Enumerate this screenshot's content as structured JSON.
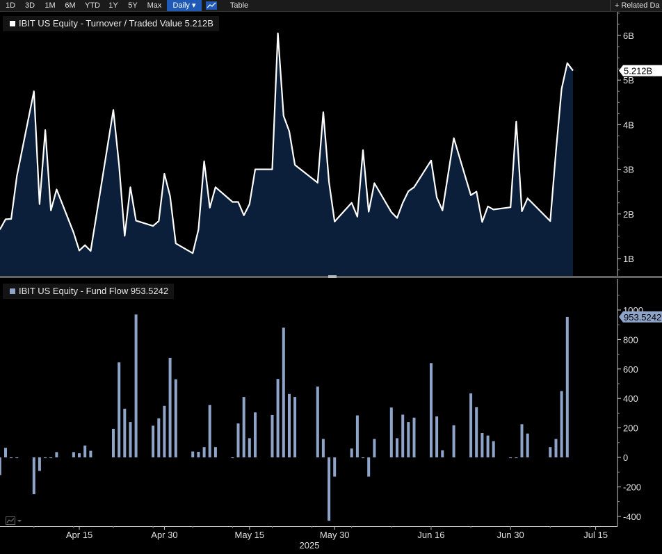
{
  "toolbar": {
    "ranges": [
      "1D",
      "3D",
      "1M",
      "6M",
      "YTD",
      "1Y",
      "5Y",
      "Max"
    ],
    "frequency": "Daily ▾",
    "chart_icon": "line-chart-icon",
    "table_label": "Table",
    "related": "+ Related Da"
  },
  "colors": {
    "area_fill": "#0b1e3a",
    "line": "#ffffff",
    "bars": "#8ea4c8",
    "axis_text": "#e0e0e0",
    "background": "#000000"
  },
  "chart_data": [
    {
      "type": "area",
      "legend": "IBIT US Equity - Turnover / Traded Value 5.212B",
      "last_value_label": "5.212B",
      "last_value": 5.212,
      "ylim": [
        0.6,
        6.6
      ],
      "yticks": [
        1,
        2,
        3,
        4,
        5,
        6
      ],
      "ytick_labels": [
        "1B",
        "2B",
        "3B",
        "4B",
        "5B",
        "6B"
      ],
      "x": [
        "2025-04-01",
        "2025-04-02",
        "2025-04-03",
        "2025-04-04",
        "2025-04-07",
        "2025-04-08",
        "2025-04-09",
        "2025-04-10",
        "2025-04-11",
        "2025-04-14",
        "2025-04-15",
        "2025-04-16",
        "2025-04-17",
        "2025-04-21",
        "2025-04-22",
        "2025-04-23",
        "2025-04-24",
        "2025-04-25",
        "2025-04-28",
        "2025-04-29",
        "2025-04-30",
        "2025-05-01",
        "2025-05-02",
        "2025-05-05",
        "2025-05-06",
        "2025-05-07",
        "2025-05-08",
        "2025-05-09",
        "2025-05-12",
        "2025-05-13",
        "2025-05-14",
        "2025-05-15",
        "2025-05-16",
        "2025-05-19",
        "2025-05-20",
        "2025-05-21",
        "2025-05-22",
        "2025-05-23",
        "2025-05-27",
        "2025-05-28",
        "2025-05-29",
        "2025-05-30",
        "2025-06-02",
        "2025-06-03",
        "2025-06-04",
        "2025-06-05",
        "2025-06-06",
        "2025-06-09",
        "2025-06-10",
        "2025-06-11",
        "2025-06-12",
        "2025-06-13",
        "2025-06-16",
        "2025-06-17",
        "2025-06-18",
        "2025-06-20",
        "2025-06-23",
        "2025-06-24",
        "2025-06-25",
        "2025-06-26",
        "2025-06-27",
        "2025-06-30",
        "2025-07-01",
        "2025-07-02",
        "2025-07-03",
        "2025-07-07",
        "2025-07-08",
        "2025-07-09",
        "2025-07-10",
        "2025-07-11"
      ],
      "values": [
        1.65,
        1.88,
        1.89,
        2.85,
        4.75,
        2.22,
        3.88,
        2.08,
        2.55,
        1.58,
        1.18,
        1.3,
        1.17,
        4.33,
        3.1,
        1.51,
        2.6,
        1.85,
        1.73,
        1.84,
        2.9,
        2.4,
        1.34,
        1.12,
        1.65,
        3.18,
        2.14,
        2.6,
        2.27,
        2.27,
        1.97,
        2.22,
        3.0,
        3.0,
        6.05,
        4.2,
        3.85,
        3.1,
        2.7,
        4.28,
        2.72,
        1.83,
        2.25,
        1.94,
        3.43,
        2.05,
        2.69,
        2.04,
        1.91,
        2.25,
        2.51,
        2.6,
        3.2,
        2.37,
        2.08,
        3.7,
        2.42,
        2.5,
        1.82,
        2.17,
        2.1,
        2.15,
        4.07,
        2.06,
        2.35,
        1.84,
        3.4,
        4.8,
        5.38,
        5.212
      ]
    },
    {
      "type": "bar",
      "legend": "IBIT US Equity - Fund Flow 953.5242",
      "last_value_label": "953.5242",
      "last_value": 953.5242,
      "ylim": [
        -450,
        1100
      ],
      "yticks": [
        -400,
        -200,
        0,
        200,
        400,
        600,
        800,
        1000
      ],
      "ytick_labels": [
        "-400",
        "-200",
        "0",
        "200",
        "400",
        "600",
        "800",
        "1000"
      ],
      "values": [
        -120,
        64,
        -5,
        -5,
        -250,
        -92,
        -5,
        -5,
        36,
        36,
        28,
        80,
        45,
        194,
        645,
        330,
        240,
        970,
        215,
        265,
        350,
        675,
        530,
        40,
        38,
        70,
        355,
        70,
        -5,
        230,
        410,
        130,
        305,
        288,
        532,
        880,
        430,
        410,
        480,
        125,
        -430,
        -130,
        60,
        285,
        -5,
        -130,
        125,
        338,
        130,
        290,
        240,
        270,
        640,
        278,
        48,
        218,
        435,
        340,
        165,
        148,
        110,
        -5,
        -5,
        225,
        162,
        70,
        125,
        450,
        953.5242
      ]
    }
  ],
  "x_axis": {
    "labels": [
      "Apr 15",
      "Apr 30",
      "May 15",
      "May 30",
      "Jun 16",
      "Jun 30",
      "Jul 15"
    ],
    "year_label": "2025"
  }
}
